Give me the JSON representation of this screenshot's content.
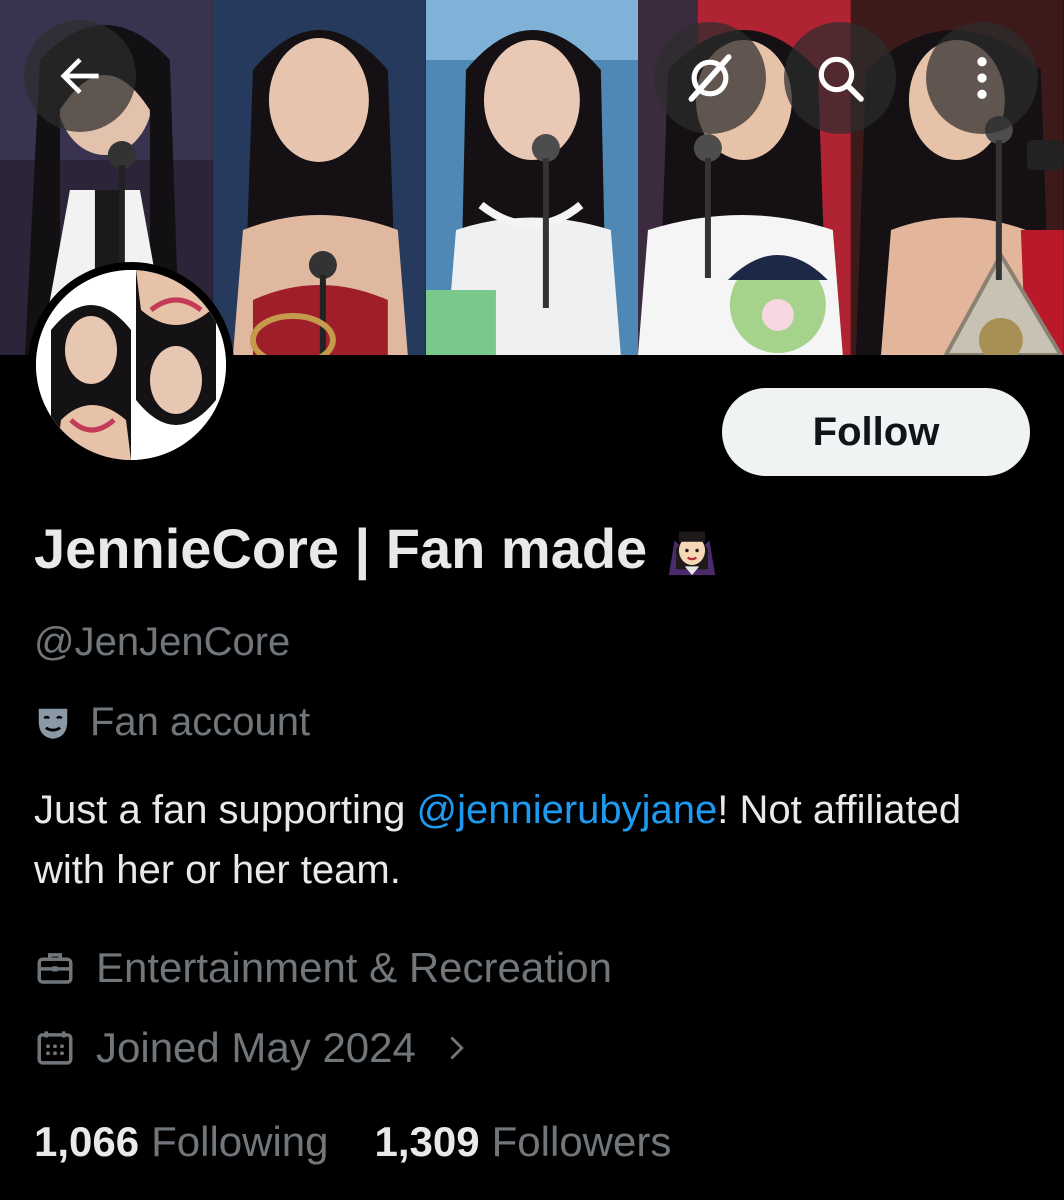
{
  "header": {
    "back_icon": "arrow-left-icon",
    "grok_icon": "grok-icon",
    "search_icon": "search-icon",
    "more_icon": "more-vertical-icon"
  },
  "banner": {
    "photos": [
      "photo-1",
      "photo-2",
      "photo-3",
      "photo-4",
      "photo-5"
    ]
  },
  "profile": {
    "follow_label": "Follow",
    "display_name": "JennieCore | Fan made",
    "emoji": "vampire-woman-emoji",
    "handle": "@JenJenCore",
    "label": "Fan account",
    "bio_before": "Just a fan supporting ",
    "bio_mention": "@jennierubyjane",
    "bio_after": "! Not affiliated with her or her team.",
    "category": "Entertainment & Recreation",
    "joined": "Joined May 2024",
    "following_count": "1,066",
    "following_label": "Following",
    "followers_count": "1,309",
    "followers_label": "Followers"
  },
  "colors": {
    "background": "#000000",
    "text": "#e7e9ea",
    "muted": "#71767b",
    "accent": "#1d9bf0",
    "follow_bg": "#eff3f4"
  }
}
